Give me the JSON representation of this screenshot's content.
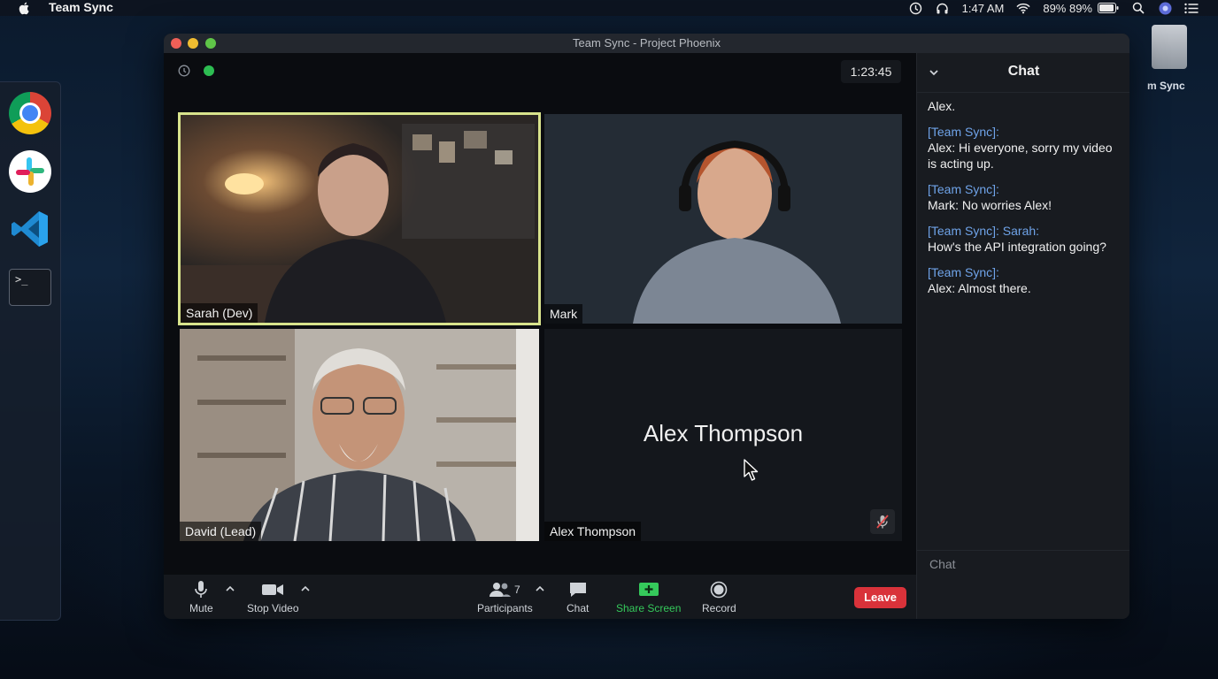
{
  "menubar": {
    "app_name": "Team Sync",
    "time": "1:47 AM",
    "battery_text": "89% 89%"
  },
  "dock": {
    "items": [
      "chrome-icon",
      "slack-icon",
      "vscode-icon",
      "terminal-icon"
    ],
    "terminal_prompt": ">_"
  },
  "desktop": {
    "drive_label": "m Sync"
  },
  "window": {
    "title": "Team Sync - Project Phoenix",
    "timer": "1:23:45"
  },
  "participants": [
    {
      "name": "Sarah (Dev)",
      "active_speaker": true
    },
    {
      "name": "Mark"
    },
    {
      "name": "David (Lead)"
    },
    {
      "name": "Alex Thompson",
      "video_off": true,
      "muted": true
    }
  ],
  "alex_center_name": "Alex Thompson",
  "toolbar": {
    "mute_label": "Mute",
    "stop_video_label": "Stop Video",
    "participants_label": "Participants",
    "participants_count": "7",
    "chat_label": "Chat",
    "share_label": "Share Screen",
    "record_label": "Record",
    "leave_label": "Leave"
  },
  "chat": {
    "title": "Chat",
    "messages": [
      {
        "from": "",
        "text": "Alex."
      },
      {
        "from": "[Team Sync]:",
        "text": "Alex: Hi everyone, sorry my video is acting up."
      },
      {
        "from": "[Team Sync]:",
        "text": "Mark: No worries Alex!"
      },
      {
        "from": "[Team Sync]: Sarah:",
        "text": "How's the API integration going?"
      },
      {
        "from": "[Team Sync]:",
        "text": "Alex: Almost there."
      }
    ],
    "input_placeholder": "Chat"
  },
  "colors": {
    "active_speaker_border": "#d8e38c",
    "leave_button": "#d9323a",
    "share_screen": "#35c95b",
    "chat_sender": "#6fa3e8",
    "status_dot": "#2dbd52"
  }
}
